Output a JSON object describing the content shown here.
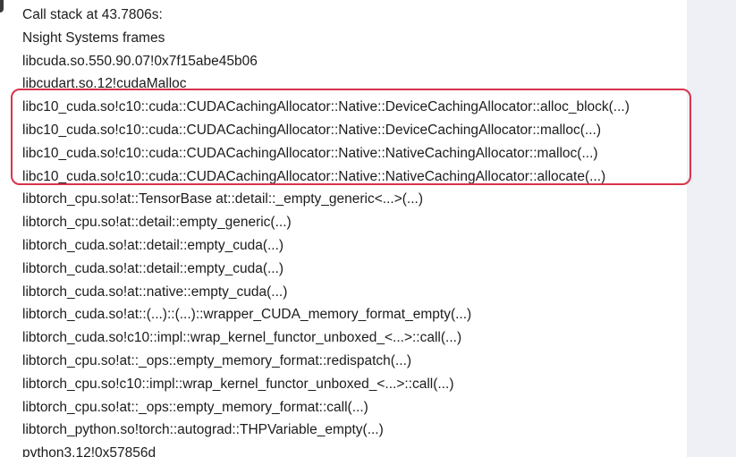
{
  "header": {
    "title": "Call stack at 43.7806s:",
    "subtitle": "Nsight Systems frames"
  },
  "frames": [
    "libcuda.so.550.90.07!0x7f15abe45b06",
    "libcudart.so.12!cudaMalloc",
    "libc10_cuda.so!c10::cuda::CUDACachingAllocator::Native::DeviceCachingAllocator::alloc_block(...)",
    "libc10_cuda.so!c10::cuda::CUDACachingAllocator::Native::DeviceCachingAllocator::malloc(...)",
    "libc10_cuda.so!c10::cuda::CUDACachingAllocator::Native::NativeCachingAllocator::malloc(...)",
    "libc10_cuda.so!c10::cuda::CUDACachingAllocator::Native::NativeCachingAllocator::allocate(...)",
    "libtorch_cpu.so!at::TensorBase at::detail::_empty_generic<...>(...)",
    "libtorch_cpu.so!at::detail::empty_generic(...)",
    "libtorch_cuda.so!at::detail::empty_cuda(...)",
    "libtorch_cuda.so!at::detail::empty_cuda(...)",
    "libtorch_cuda.so!at::native::empty_cuda(...)",
    "libtorch_cuda.so!at::(...)::(...)::wrapper_CUDA_memory_format_empty(...)",
    "libtorch_cuda.so!c10::impl::wrap_kernel_functor_unboxed_<...>::call(...)",
    "libtorch_cpu.so!at::_ops::empty_memory_format::redispatch(...)",
    "libtorch_cpu.so!c10::impl::wrap_kernel_functor_unboxed_<...>::call(...)",
    "libtorch_cpu.so!at::_ops::empty_memory_format::call(...)",
    "libtorch_python.so!torch::autograd::THPVariable_empty(...)",
    "python3.12!0x57856d"
  ],
  "highlight": {
    "color": "#d8344b",
    "frame_indices": [
      2,
      3,
      4,
      5
    ]
  }
}
